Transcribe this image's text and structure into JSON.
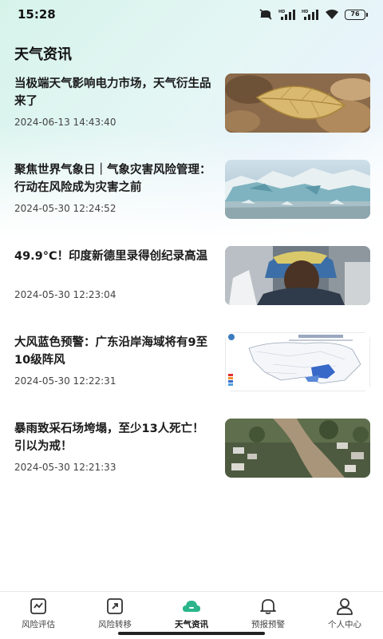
{
  "status_bar": {
    "time": "15:28",
    "battery": "76",
    "icons": [
      "mute-icon",
      "hd-signal-icon",
      "hd-signal-icon",
      "wifi-icon",
      "battery-icon"
    ]
  },
  "page": {
    "title": "天气资讯"
  },
  "news": [
    {
      "title": "当极端天气影响电力市场，天气衍生品来了",
      "time": "2024-06-13 14:43:40",
      "image": "dry-leaf-photo"
    },
    {
      "title": "聚焦世界气象日｜气象灾害风险管理：行动在风险成为灾害之前",
      "time": "2024-05-30 12:24:52",
      "image": "glacier-photo"
    },
    {
      "title": "49.9°C！印度新德里录得创纪录高温",
      "time": "2024-05-30 12:23:04",
      "image": "heat-man-photo"
    },
    {
      "title": "大风蓝色预警：广东沿岸海域将有9至10级阵风",
      "time": "2024-05-30 12:22:31",
      "image": "wind-warning-map"
    },
    {
      "title": "暴雨致采石场垮塌，至少13人死亡！引以为戒！",
      "time": "2024-05-30 12:21:33",
      "image": "landslide-photo"
    }
  ],
  "tabs": [
    {
      "label": "风险评估",
      "icon": "assessment-icon",
      "active": false
    },
    {
      "label": "风险转移",
      "icon": "transfer-icon",
      "active": false
    },
    {
      "label": "天气资讯",
      "icon": "cloud-icon",
      "active": true
    },
    {
      "label": "预报预警",
      "icon": "bell-icon",
      "active": false
    },
    {
      "label": "个人中心",
      "icon": "person-icon",
      "active": false
    }
  ],
  "colors": {
    "accent": "#2bb58a",
    "header_gradient_start": "#d6f3ea",
    "header_gradient_end": "#e8f3fb"
  }
}
